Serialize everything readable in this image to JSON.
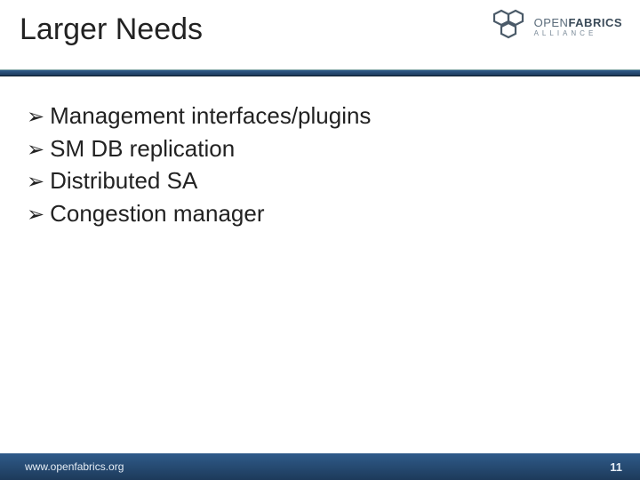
{
  "header": {
    "title": "Larger Needs",
    "logo": {
      "word1": "OPEN",
      "word2": "FABRICS",
      "sub": "ALLIANCE"
    }
  },
  "bullets": [
    "Management interfaces/plugins",
    "SM DB replication",
    "Distributed SA",
    "Congestion manager"
  ],
  "footer": {
    "url": "www.openfabrics.org",
    "page": "11"
  }
}
